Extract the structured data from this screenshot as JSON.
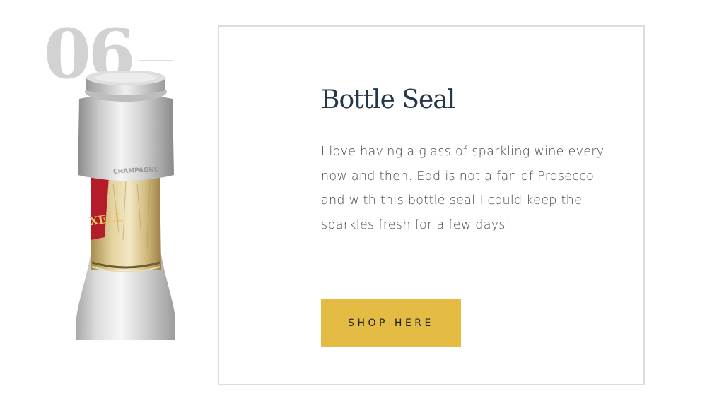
{
  "feature": {
    "number": "06",
    "title": "Bottle Seal",
    "description": "I love having a glass of sparkling wine every now and then. Edd is not a fan of Prosecco and with this bottle seal I could keep the sparkles fresh for a few days!",
    "button_label": "SHOP HERE"
  },
  "product_image": {
    "stopper_engraving": "CHAMPAGNE",
    "label_text": "XELL"
  },
  "colors": {
    "number": "#d2d2d2",
    "title": "#25374a",
    "body_text": "#4b4b4b",
    "button_background": "#e4bc43",
    "card_border": "#dcdcdc"
  }
}
